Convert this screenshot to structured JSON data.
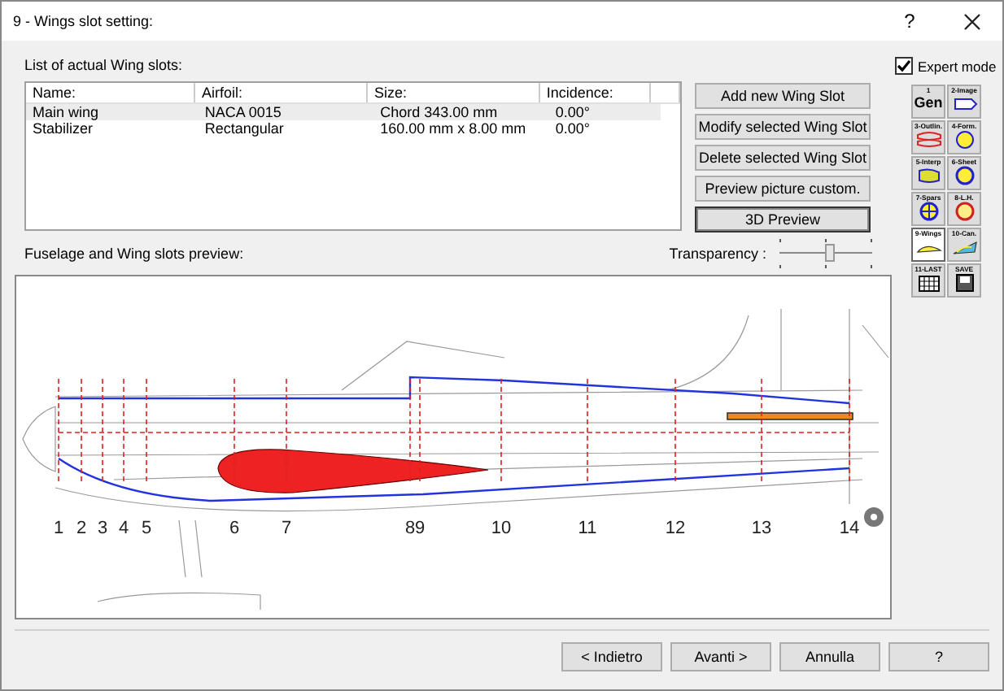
{
  "window": {
    "title": "9 - Wings slot setting:",
    "help": "?"
  },
  "slots": {
    "label": "List of actual Wing slots:",
    "columns": [
      "Name:",
      "Airfoil:",
      "Size:",
      "Incidence:"
    ],
    "rows": [
      {
        "cells": [
          "Main wing",
          "NACA 0015",
          "Chord 343.00 mm",
          "0.00°"
        ],
        "selected": true
      },
      {
        "cells": [
          "Stabilizer",
          "Rectangular",
          "160.00 mm x 8.00 mm",
          "0.00°"
        ],
        "selected": false
      }
    ]
  },
  "actions": [
    {
      "label": "Add new Wing Slot",
      "default": false
    },
    {
      "label": "Modify selected Wing Slot",
      "default": false
    },
    {
      "label": "Delete selected Wing Slot",
      "default": false
    },
    {
      "label": "Preview picture custom.",
      "default": false
    },
    {
      "label": "3D Preview",
      "default": true
    }
  ],
  "expert_mode": {
    "label": "Expert mode",
    "checked": true
  },
  "tools": [
    {
      "label": "1",
      "glyph": "Gen",
      "selected": false
    },
    {
      "label": "2-Image",
      "selected": false
    },
    {
      "label": "3-Outlin.",
      "selected": false
    },
    {
      "label": "4-Form.",
      "selected": false
    },
    {
      "label": "5-Interp",
      "selected": false
    },
    {
      "label": "6-Sheet",
      "selected": false
    },
    {
      "label": "7-Spars",
      "selected": false
    },
    {
      "label": "8-L.H.",
      "selected": false
    },
    {
      "label": "9-Wings",
      "selected": true
    },
    {
      "label": "10-Can.",
      "selected": false
    },
    {
      "label": "11-LAST",
      "selected": false
    },
    {
      "label": "SAVE",
      "selected": false
    }
  ],
  "preview": {
    "label": "Fuselage and Wing slots preview:",
    "transparency": {
      "label": "Transparency :",
      "level": 0.55
    },
    "stations": [
      "1",
      "2",
      "3",
      "4",
      "5",
      "6",
      "7",
      "8",
      "9",
      "10",
      "11",
      "12",
      "13",
      "14"
    ]
  },
  "footer": {
    "buttons": [
      "< Indietro",
      "Avanti >",
      "Annulla",
      "?"
    ]
  }
}
